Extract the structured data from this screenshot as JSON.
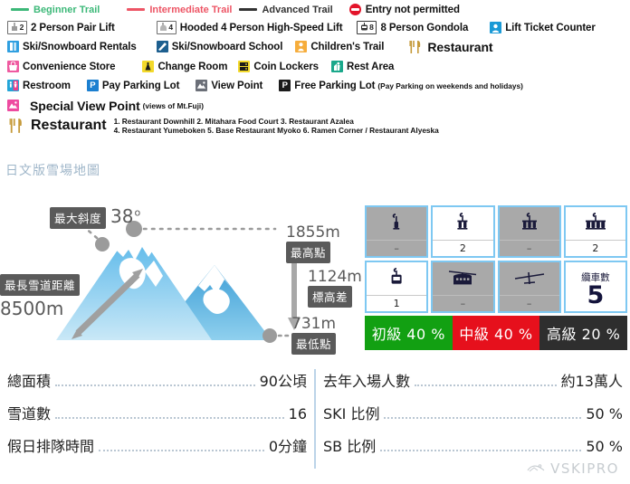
{
  "legend": {
    "trails": [
      {
        "label": "Beginner Trail",
        "color": "#3cb878",
        "icon": "line-swatch-green"
      },
      {
        "label": "Intermediate Trail",
        "color": "#ed5565",
        "icon": "line-swatch-red"
      },
      {
        "label": "Advanced Trail",
        "color": "#333333",
        "icon": "line-swatch-black"
      }
    ],
    "no_entry": {
      "label": "Entry not permitted",
      "icon": "no-entry-icon",
      "color": "#e3142a"
    },
    "row2": [
      {
        "label": "2 Person Pair Lift",
        "icon": "pair-lift-icon",
        "badge": "2"
      },
      {
        "label": "Hooded 4 Person High-Speed Lift",
        "icon": "hooded-lift-icon",
        "badge": "4"
      },
      {
        "label": "8 Person Gondola",
        "icon": "gondola-icon",
        "badge": "8"
      },
      {
        "label": "Lift Ticket Counter",
        "icon": "ticket-counter-icon",
        "badge": ""
      }
    ],
    "row3": [
      {
        "label": "Ski/Snowboard Rentals",
        "icon": "ski-rental-icon"
      },
      {
        "label": "Ski/Snowboard School",
        "icon": "ski-school-icon"
      },
      {
        "label": "Children's Trail",
        "icon": "childrens-trail-icon"
      },
      {
        "label": "Restaurant",
        "icon": "restaurant-icon"
      }
    ],
    "row4": [
      {
        "label": "Convenience Store",
        "icon": "convenience-store-icon"
      },
      {
        "label": "Change Room",
        "icon": "change-room-icon"
      },
      {
        "label": "Coin Lockers",
        "icon": "coin-locker-icon"
      },
      {
        "label": "Rest Area",
        "icon": "rest-area-icon"
      }
    ],
    "row5": [
      {
        "label": "Restroom",
        "icon": "restroom-icon",
        "note": ""
      },
      {
        "label": "Pay Parking Lot",
        "icon": "pay-parking-icon",
        "note": ""
      },
      {
        "label": "View Point",
        "icon": "view-point-icon",
        "note": ""
      },
      {
        "label": "Free Parking Lot",
        "icon": "free-parking-icon",
        "note": "(Pay Parking on weekends and holidays)"
      }
    ],
    "special": {
      "label": "Special View Point",
      "note": "(views of Mt.Fuji)",
      "icon": "special-view-point-icon"
    },
    "restaurants": {
      "label": "Restaurant",
      "icon": "restaurant-icon",
      "line1": "1. Restaurant Downhill 2. Mitahara Food Court 3. Restaurant Azalea",
      "line2": "4. Restaurant Yumeboken 5. Base Restaurant Myoko 6. Ramen Corner / Restaurant Alyeska"
    }
  },
  "section": {
    "title": "日文版雪場地圖"
  },
  "mountain": {
    "max_slope": {
      "chip": "最大斜度",
      "value": "38",
      "unit": "o"
    },
    "longest_run": {
      "chip": "最長雪道距離",
      "value": "8500m"
    },
    "summit": {
      "value": "1855m",
      "chip": "最高點"
    },
    "vertical": {
      "value": "1124m",
      "chip": "標高差"
    },
    "base": {
      "value": "731m",
      "chip": "最低點"
    }
  },
  "lifts": {
    "cells": [
      {
        "icon": "single-chair-lift-icon",
        "count": "–",
        "active": false
      },
      {
        "icon": "pair-chair-lift-icon",
        "count": "2",
        "active": true
      },
      {
        "icon": "triple-chair-lift-icon",
        "count": "–",
        "active": false
      },
      {
        "icon": "quad-chair-lift-icon",
        "count": "2",
        "active": true
      },
      {
        "icon": "gondola-cabin-icon",
        "count": "1",
        "active": true
      },
      {
        "icon": "ropeway-tram-icon",
        "count": "–",
        "active": false
      },
      {
        "icon": "surface-tow-lift-icon",
        "count": "–",
        "active": false
      }
    ],
    "total": {
      "label": "纜車數",
      "value": "5"
    }
  },
  "difficulty": {
    "segments": [
      {
        "label": "初級 40 %",
        "color": "#12a012",
        "name": "beginner"
      },
      {
        "label": "中級 40 %",
        "color": "#e6101c",
        "name": "intermediate"
      },
      {
        "label": "高級 20 %",
        "color": "#2e2e2e",
        "name": "advanced"
      }
    ]
  },
  "stats": {
    "left": [
      {
        "key": "總面積",
        "value": "90公頃"
      },
      {
        "key": "雪道數",
        "value": "16"
      },
      {
        "key": "假日排隊時間",
        "value": "0分鐘"
      }
    ],
    "right": [
      {
        "key": "去年入場人數",
        "value": "約13萬人"
      },
      {
        "key": "SKI 比例",
        "value": "50 %"
      },
      {
        "key": "SB 比例",
        "value": "50 %"
      }
    ]
  },
  "watermark": {
    "text": "VSKIPRO",
    "icon": "vskipro-logo-icon"
  },
  "chart_data": {
    "type": "bar",
    "title": "日文版雪場地圖 — 雪道難易度比例",
    "categories": [
      "初級 (Beginner)",
      "中級 (Intermediate)",
      "高級 (Advanced)"
    ],
    "values": [
      40,
      40,
      20
    ],
    "ylabel": "%",
    "ylim": [
      0,
      100
    ],
    "colors": [
      "#12a012",
      "#e6101c",
      "#2e2e2e"
    ],
    "annotations": {
      "summit_m": 1855,
      "base_m": 731,
      "vertical_drop_m": 1124,
      "max_slope_deg": 38,
      "longest_run_m": 8500,
      "total_area_ha": 90,
      "number_of_courses": 16,
      "holiday_queue_minutes": 0,
      "visitors_last_year": "約13萬人",
      "ski_ratio_pct": 50,
      "snowboard_ratio_pct": 50,
      "lift_counts": {
        "single": "–",
        "pair": 2,
        "triple": "–",
        "quad": 2,
        "gondola": 1,
        "ropeway": "–",
        "surface_tow": "–",
        "total": 5
      }
    }
  }
}
